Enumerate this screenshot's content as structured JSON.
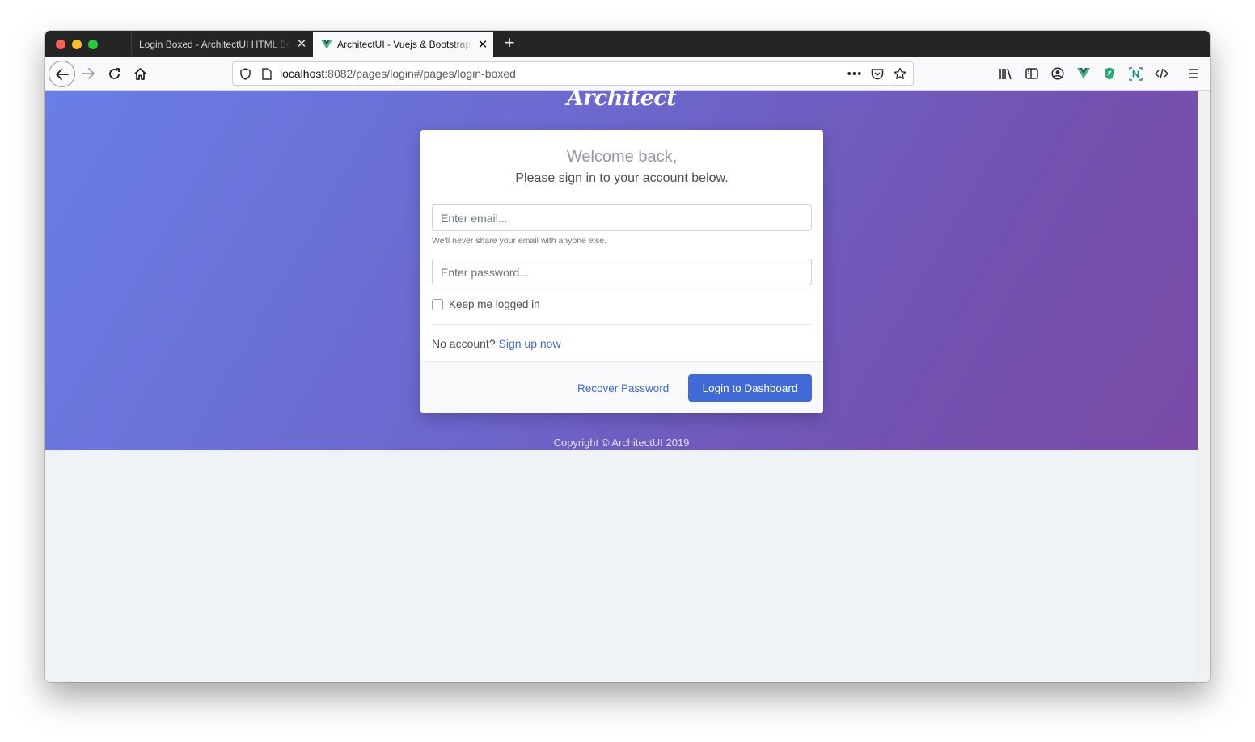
{
  "browser": {
    "tabs": [
      {
        "title": "Login Boxed - ArchitectUI HTML Bootstrap",
        "active": false
      },
      {
        "title": "ArchitectUI - Vuejs & Bootstrap",
        "active": true
      }
    ],
    "url_host": "localhost",
    "url_rest": ":8082/pages/login#/pages/login-boxed",
    "toolbar_icons": [
      "library-icon",
      "sidebar-icon",
      "account-icon",
      "vue-devtools-icon",
      "shield-extension-icon",
      "notion-extension-icon",
      "dev-tools-icon",
      "menu-icon"
    ]
  },
  "page": {
    "logo": "Architect",
    "welcome": "Welcome back,",
    "subtitle": "Please sign in to your account below.",
    "email_placeholder": "Enter email...",
    "email_help": "We'll never share your email with anyone else.",
    "password_placeholder": "Enter password...",
    "keep_logged_in": "Keep me logged in",
    "no_account": "No account?",
    "signup_link": "Sign up now",
    "recover_password": "Recover Password",
    "login_button": "Login to Dashboard",
    "copyright": "Copyright © ArchitectUI 2019"
  },
  "colors": {
    "primary": "#3f6ad8",
    "gradient_start": "#6a7ee6",
    "gradient_end": "#7a4aa6"
  }
}
